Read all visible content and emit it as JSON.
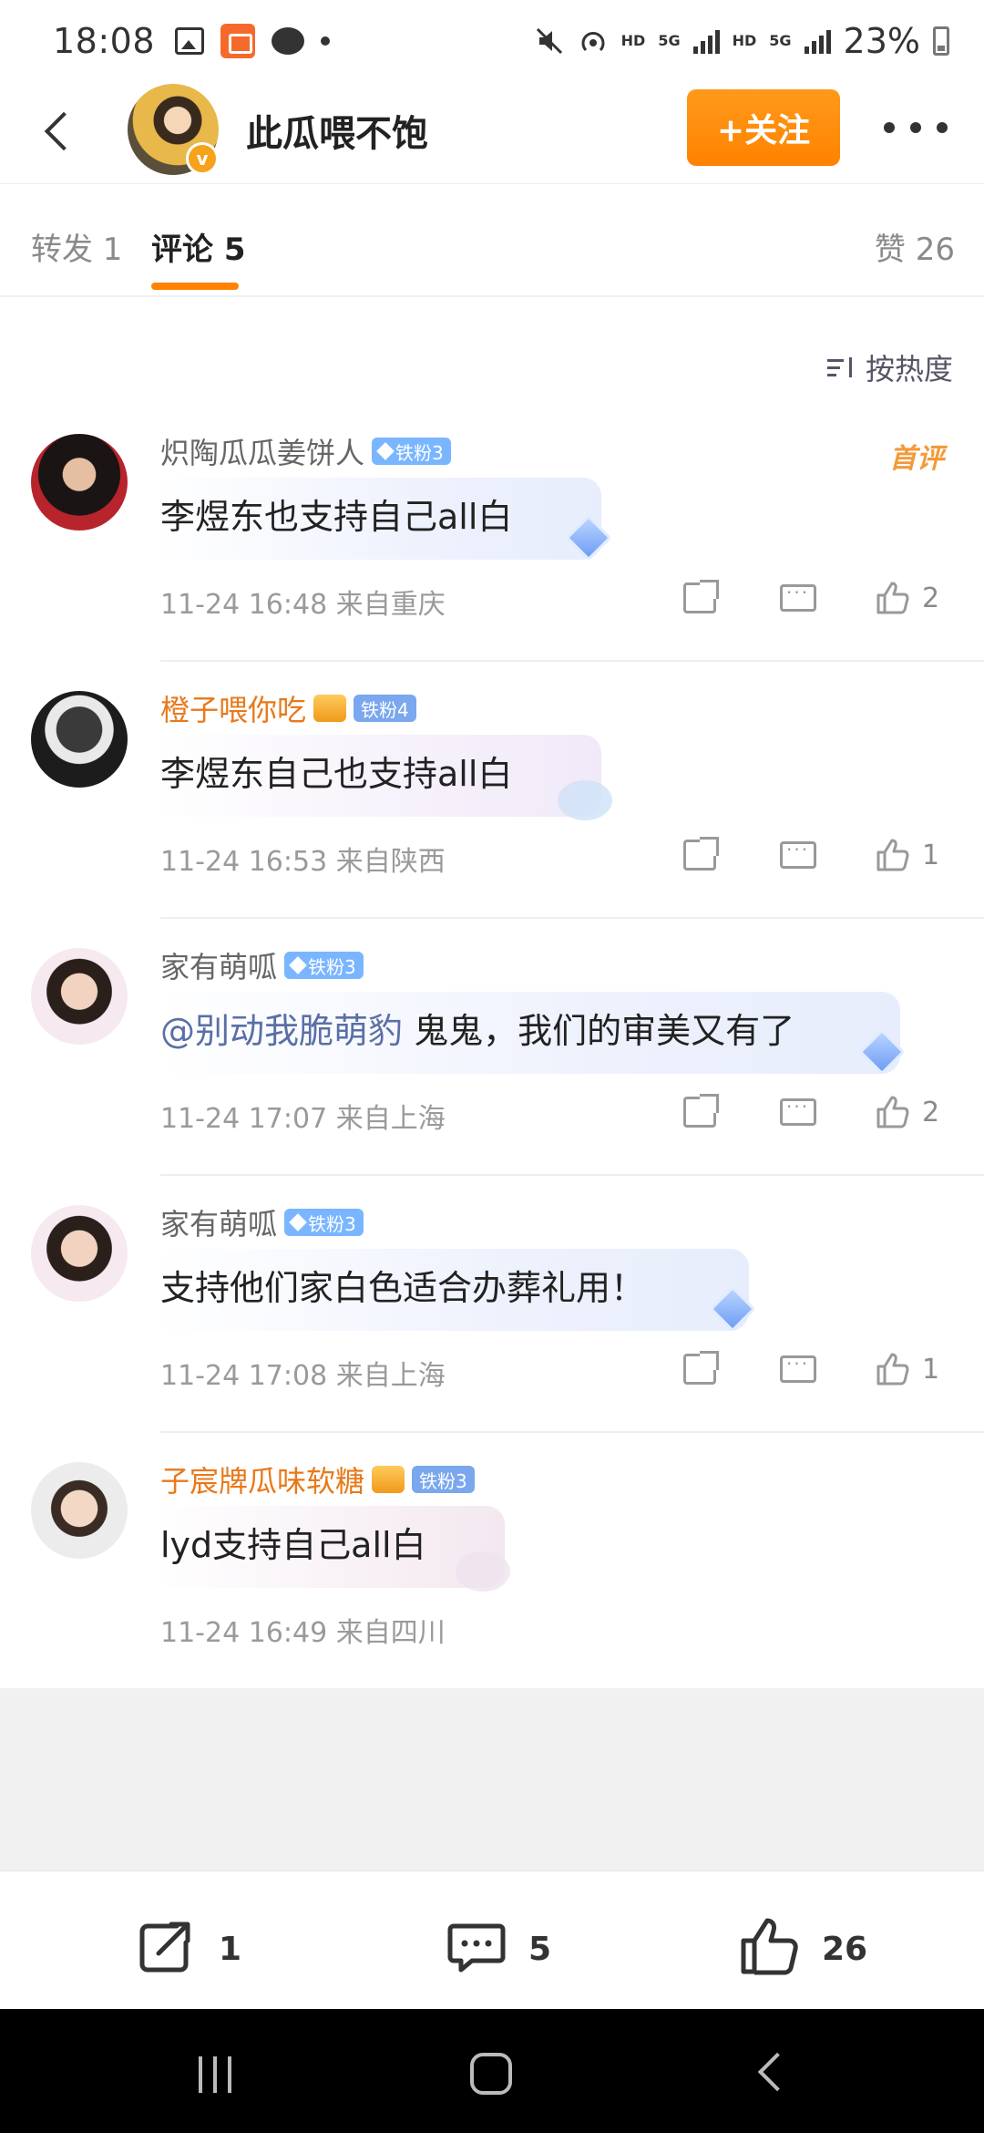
{
  "status_bar": {
    "time": "18:08",
    "battery": "23%",
    "hd1": "HD",
    "net1": "5G",
    "hd2": "HD",
    "net2": "5G"
  },
  "header": {
    "title": "此瓜喂不饱",
    "follow_label": "+关注"
  },
  "tabs": {
    "repost": "转发 1",
    "comments": "评论 5",
    "likes": "赞 26"
  },
  "sort_label": "按热度",
  "comments": [
    {
      "name": "炽陶瓜瓜姜饼人",
      "badge": "铁粉3",
      "vip": false,
      "first_tag": "首评",
      "text": "李煜东也支持自己all白",
      "time": "11-24 16:48",
      "location": "来自重庆",
      "likes": "2"
    },
    {
      "name": "橙子喂你吃",
      "badge": "铁粉4",
      "vip": true,
      "text": "李煜东自己也支持all白",
      "time": "11-24 16:53",
      "location": "来自陕西",
      "likes": "1"
    },
    {
      "name": "家有萌呱",
      "badge": "铁粉3",
      "vip": false,
      "mention": "@别动我脆萌豹",
      "text": " 鬼鬼，我们的审美又有了",
      "time": "11-24 17:07",
      "location": "来自上海",
      "likes": "2"
    },
    {
      "name": "家有萌呱",
      "badge": "铁粉3",
      "vip": false,
      "text": "支持他们家白色适合办葬礼用！",
      "time": "11-24 17:08",
      "location": "来自上海",
      "likes": "1"
    },
    {
      "name": "子宸牌瓜味软糖",
      "badge": "铁粉3",
      "vip": true,
      "text": "lyd支持自己all白",
      "time": "11-24 16:49",
      "location": "来自四川"
    }
  ],
  "bottom_bar": {
    "repost_count": "1",
    "comment_count": "5",
    "like_count": "26"
  },
  "icons": {
    "back": "chevron-left-icon",
    "more": "more-dots-icon",
    "sort": "sort-icon",
    "share": "share-icon",
    "reply": "comment-icon",
    "like": "thumbs-up-icon"
  },
  "colors": {
    "accent": "#ff8200",
    "vip_name": "#e8791a",
    "badge": "#7ab6ff",
    "mention": "#5a6fa6"
  }
}
